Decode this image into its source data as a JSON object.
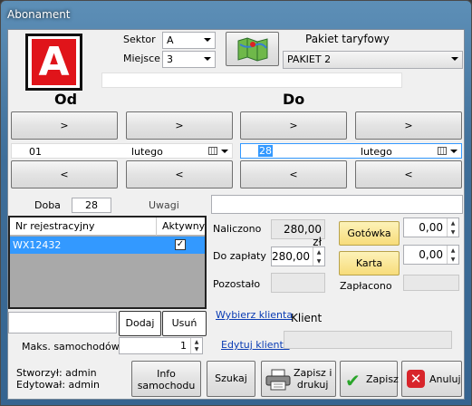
{
  "window": {
    "title": "Abonament"
  },
  "header": {
    "logo_letter": "A",
    "sector_label": "Sektor",
    "sector_value": "A",
    "place_label": "Miejsce",
    "place_value": "3",
    "tariff_label": "Pakiet taryfowy",
    "tariff_value": "PAKIET 2"
  },
  "from": {
    "heading": "Od",
    "up_label": ">",
    "down_label": "<",
    "day": "01",
    "month": "lutego"
  },
  "to": {
    "heading": "Do",
    "up_label": ">",
    "down_label": "<",
    "day": "28",
    "month": "lutego"
  },
  "doba": {
    "label": "Doba",
    "value": "28"
  },
  "uwagi": {
    "label": "Uwagi",
    "value": ""
  },
  "vehicles": {
    "col_nr": "Nr rejestracyjny",
    "col_active": "Aktywny",
    "rows": [
      {
        "nr": "WX12432",
        "active": "✓"
      }
    ],
    "add_label": "Dodaj",
    "remove_label": "Usuń",
    "max_label": "Maks. samochodów",
    "max_value": "1"
  },
  "payment": {
    "charged_label": "Naliczono",
    "charged_value": "280,00 zł",
    "topay_label": "Do zapłaty",
    "topay_value": "280,00",
    "remaining_label": "Pozostało",
    "cash_label": "Gotówka",
    "cash_value": "0,00",
    "card_label": "Karta",
    "card_value": "0,00",
    "paid_label": "Zapłacono"
  },
  "client": {
    "choose_link": "Wybierz klienta",
    "client_label": "Klient",
    "edit_link": "Edytuj klienta"
  },
  "footer": {
    "created": "Stworzył: admin",
    "edited": "Edytował: admin",
    "info_btn": "Info\nsamochodu",
    "search_btn": "Szukaj",
    "print_btn": "Zapisz i\ndrukuj",
    "save_btn": "Zapisz",
    "cancel_btn": "Anuluj"
  },
  "colors": {
    "logo_red": "#e0141a",
    "selection": "#3399ff",
    "gold_button": "#f7dc7a"
  }
}
